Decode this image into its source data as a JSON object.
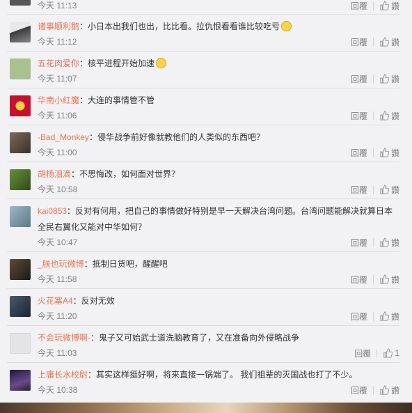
{
  "reply_label": "回覆",
  "like_label_default": "讚",
  "comments": [
    {
      "user": "",
      "text": "",
      "time": "今天 11:13",
      "like": "讚"
    },
    {
      "user": "诸事顺利鹅",
      "text": "：小日本出我们也出，比比看。拉仇恨看看谁比较吃亏",
      "time": "今天 11:12",
      "like": "讚"
    },
    {
      "user": "五花肉爱你",
      "text": "：核平进程开始加速",
      "time": "今天 11:07",
      "like": "讚"
    },
    {
      "user": "华南小红魔",
      "text": "：大连的事情管不管",
      "time": "今天 11:06",
      "like": "讚"
    },
    {
      "user": "-Bad_Monkey",
      "text": "：侵华战争前好像就教他们的人类似的东西吧？",
      "time": "今天 11:00",
      "like": "讚"
    },
    {
      "user": "胡杨泪滴",
      "text": "：不思悔改，如何面对世界？",
      "time": "今天 10:58",
      "like": "讚"
    },
    {
      "user": "kai0853",
      "text": "：反对有何用，把自己的事情做好特别是早一天解决台湾问题。台湾问题能解决就算日本",
      "text2": "全民右翼化又能对中华如何？",
      "time": "今天 10:47",
      "like": "讚"
    },
    {
      "user": "_朕也玩微博",
      "text": "：抵制日货吧，醒醒吧",
      "time": "今天 11:58",
      "like": "讚"
    },
    {
      "user": "火花塞A4",
      "text": "：反对无效",
      "time": "今天 11:20",
      "like": "讚"
    },
    {
      "user": "不会玩微博啊-",
      "text": "：鬼子又可始武士道洗脑教育了，又在准备向外侵略战争",
      "time": "今天 11:03",
      "like": "1"
    },
    {
      "user": "上庸长水校尉",
      "text": "：其实这样挺好啊，将来直接一锅端了。 我们祖辈的灭国战也打了不少。",
      "time": "今天 10:38",
      "like": "讚"
    }
  ]
}
